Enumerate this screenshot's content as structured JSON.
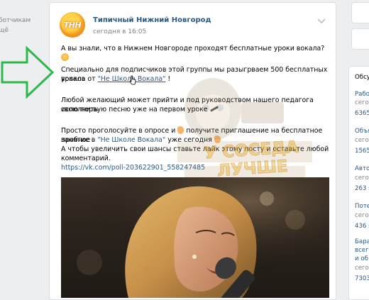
{
  "left": {
    "line1": "ботчикам",
    "line2": "щё"
  },
  "post": {
    "group_name": "Типичный Нижний Новгород",
    "time": "сегодня в 16:05",
    "avatar_text": "ТНН",
    "line1": "А вы знали, что в Нижнем Новгороде проходят бесплатные уроки вокала?",
    "line2a": "Специально для подписчиков этой группы мы разыгрваем 500 бесплатных уроков",
    "line2b_prefix": "вокала от ",
    "line2b_link": "\"Не Школа Вокала\"",
    "line2b_suffix": " !",
    "line3a": "Любой желающий может прийти и под руководством нашего педагога исполнить",
    "line3b": "свою первую песню уже на первом уроке",
    "line4a_prefix": "Просто проголосуйте в опросе и",
    "line4a_suffix": "получите приглашение на бесплатное пробное",
    "line4b_prefix": "занятие в ",
    "line4b_link": "\"Не Школе Вокала\"",
    "line4b_suffix": " уже сегодня",
    "line5a": "А чтобы увеличить свои шансы ставьте лайк этому посту и оставьте любой",
    "line5b": "комментарий.",
    "poll_link": "https://vk.com/poll-203622901_558247485",
    "watermark_line1": "У СОСЕДА",
    "watermark_line2": "ЛУЧШЕ"
  },
  "right": {
    "l1": "Обсу",
    "l2": "Рабо",
    "l3": "сего",
    "l4": "6365",
    "l5": "Объя",
    "l6": "сего",
    "l7": "1565",
    "l8": "Авто",
    "l9": "сего",
    "l10": "263 s",
    "l11": "Поте",
    "l12": "сего",
    "l13": "436 s",
    "l14": "Бара",
    "l15": "всег",
    "l16": "и об",
    "l17": "сего",
    "l18": "7303"
  },
  "colors": {
    "link": "#2a5885",
    "arrow": "#2db84a",
    "background": "#edeef0"
  }
}
